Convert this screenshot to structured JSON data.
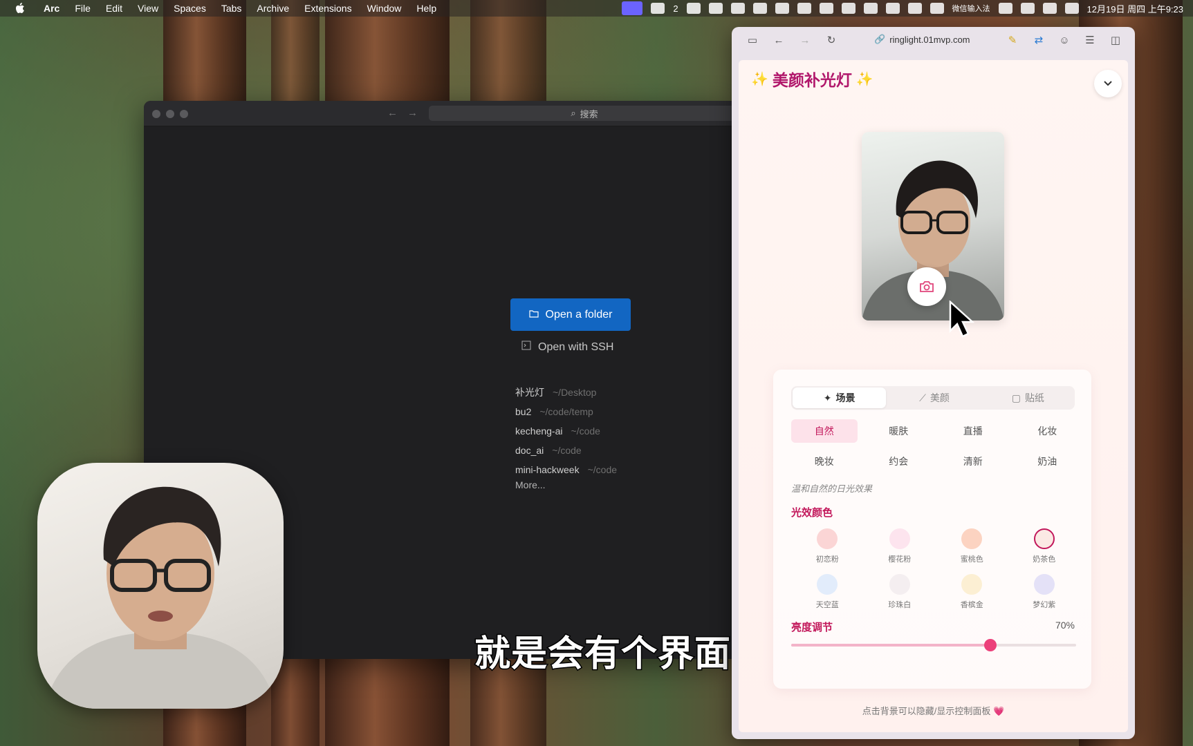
{
  "menubar": {
    "app_name": "Arc",
    "items": [
      "File",
      "Edit",
      "View",
      "Spaces",
      "Tabs",
      "Archive",
      "Extensions",
      "Window",
      "Help"
    ],
    "tray": {
      "badge_count": "2",
      "ime_label": "微信输入法",
      "datetime": "12月19日 周四 上午9:23"
    }
  },
  "editor": {
    "search_placeholder": "搜索",
    "open_folder_label": "Open a folder",
    "open_ssh_label": "Open with SSH",
    "recent": [
      {
        "name": "补光灯",
        "path": "~/Desktop"
      },
      {
        "name": "bu2",
        "path": "~/code/temp"
      },
      {
        "name": "kecheng-ai",
        "path": "~/code"
      },
      {
        "name": "doc_ai",
        "path": "~/code"
      },
      {
        "name": "mini-hackweek",
        "path": "~/code"
      }
    ],
    "more_label": "More..."
  },
  "subtitle": "就是会有个界面",
  "browser": {
    "url": "ringlight.01mvp.com",
    "app": {
      "title_left": "✨",
      "title": "美颜补光灯",
      "title_right": "✨",
      "tabs": [
        {
          "label": "场景",
          "icon": "sparkle-icon",
          "active": true
        },
        {
          "label": "美颜",
          "icon": "magic-wand-icon",
          "active": false
        },
        {
          "label": "贴纸",
          "icon": "sticker-icon",
          "active": false
        }
      ],
      "scenes": [
        {
          "label": "自然",
          "active": true
        },
        {
          "label": "暖肤"
        },
        {
          "label": "直播"
        },
        {
          "label": "化妆"
        },
        {
          "label": "晚妆"
        },
        {
          "label": "约会"
        },
        {
          "label": "清新"
        },
        {
          "label": "奶油"
        }
      ],
      "scene_description": "温和自然的日光效果",
      "color_section_title": "光效颜色",
      "colors": [
        {
          "label": "初恋粉",
          "color": "#fbd5d5"
        },
        {
          "label": "樱花粉",
          "color": "#fde4ee"
        },
        {
          "label": "蜜桃色",
          "color": "#fcd3c1"
        },
        {
          "label": "奶茶色",
          "color": "#fbe9e4",
          "selected": true
        },
        {
          "label": "天空蓝",
          "color": "#e2ecfb"
        },
        {
          "label": "珍珠白",
          "color": "#f4eef0"
        },
        {
          "label": "香槟金",
          "color": "#fcefd3"
        },
        {
          "label": "梦幻紫",
          "color": "#e4e1f7"
        }
      ],
      "brightness_title": "亮度调节",
      "brightness_value": "70%",
      "brightness_fraction": 0.7,
      "hint": "点击背景可以隐藏/显示控制面板 💗"
    }
  }
}
